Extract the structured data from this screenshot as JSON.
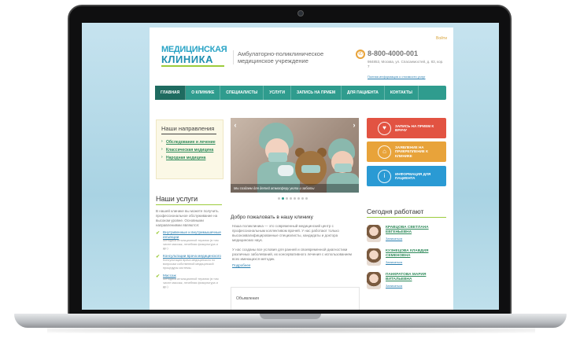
{
  "site": {
    "login_label": "Войти",
    "logo_line1": "МЕДИЦИНСКАЯ",
    "logo_line2": "КЛИНИКА",
    "tagline": "Амбулаторно-поликлиническое медицинское учреждение",
    "phone": "8-800-4000-001",
    "address": "984853, Москва, ул. Спасаемостей, д. 83, кор. 7",
    "address_link": "Полная информация о стоимости услуг"
  },
  "nav": {
    "items": [
      {
        "label": "ГЛАВНАЯ"
      },
      {
        "label": "О КЛИНИКЕ"
      },
      {
        "label": "СПЕЦИАЛИСТЫ"
      },
      {
        "label": "УСЛУГИ"
      },
      {
        "label": "ЗАПИСЬ НА ПРИЕМ"
      },
      {
        "label": "ДЛЯ ПАЦИЕНТА"
      },
      {
        "label": "КОНТАКТЫ"
      }
    ]
  },
  "directions": {
    "title": "Наши направления",
    "items": [
      {
        "label": "Обследование и лечение"
      },
      {
        "label": "Классическая медицина"
      },
      {
        "label": "Народная медицина"
      }
    ]
  },
  "services": {
    "title": "Наши услуги",
    "intro": "В нашей клинике вы можете получить профессиональное обслуживание на высоком уровне. Основными направлениями являются:",
    "items": [
      {
        "label": "Внутривенные и внутримышечные инъекции",
        "desc": "Методика инъекционной терапии (в том числе массаж, лечебная физкультура и др.)"
      },
      {
        "label": "Консультации врача медицинского",
        "desc": "Консультация врача медицинского по вопросам собственной медицинской процедуры системы."
      },
      {
        "label": "Массаж",
        "desc": "Методика инъекционной терапии (в том числе массаж, лечебная физкультура и др.)"
      }
    ]
  },
  "slider": {
    "caption": "Мы создаем для детей атмосферу уюта и заботы",
    "prev_icon": "‹",
    "next_icon": "›",
    "dot_count": 8,
    "active_dot": 1
  },
  "welcome": {
    "title": "Добро пожаловать в нашу клинику",
    "p1": "Наша поликлиника — это современный медицинский центр с профессиональным коллективом врачей. У нас работают только высококвалифицированные специалисты, кандидаты и доктора медицинских наук.",
    "p2": "У нас созданы все условия для ранней и своевременной диагностики различных заболеваний, их консервативного лечения с использованием всех имеющихся методик.",
    "more_link": "Подробнее",
    "announcements_title": "Объявления"
  },
  "cta": {
    "appointment": "ЗАПИСЬ НА ПРИЕМ К ВРАЧУ",
    "attach": "ЗАЯВЛЕНИЕ НА ПРИКРЕПЛЕНИЕ К КЛИНИКЕ",
    "info": "ИНФОРМАЦИЯ ДЛЯ ПАЦИЕНТА",
    "appointment_icon": "heart-icon",
    "attach_icon": "house-icon",
    "info_icon": "info-card-icon"
  },
  "today": {
    "title": "Сегодня работают",
    "doctors": [
      {
        "name": "КРАВЦОВА СВЕТЛАНА ЕВГЕНЬЕВНА",
        "action": "Записаться"
      },
      {
        "name": "КУЗНЕЦОВА КЛАВДИЯ СЕМЕНОВНА",
        "action": "Записаться"
      },
      {
        "name": "ПАНКРАТОВА МАРИЯ ВИТАЛЬЕВНА",
        "action": "Записаться"
      }
    ]
  },
  "colors": {
    "nav_bg": "#2f9c8e",
    "accent_green": "#9ccc3c",
    "logo_blue": "#2aa4c6",
    "cta_red": "#e25342",
    "cta_yellow": "#e8a33a",
    "cta_blue": "#2a9ad4"
  }
}
